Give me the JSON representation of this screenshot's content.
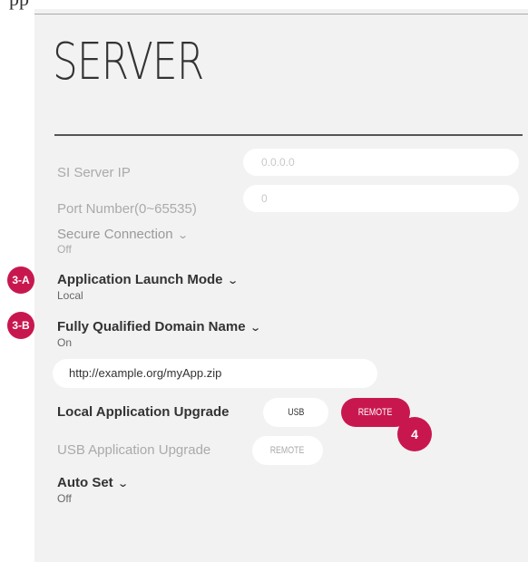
{
  "page_top_text": "pp",
  "title": "SERVER",
  "si_server_ip": {
    "label": "SI Server IP",
    "value": "0.0.0.0"
  },
  "port_number": {
    "label": "Port Number(0~65535)",
    "value": "0"
  },
  "secure_connection": {
    "label": "Secure Connection",
    "value": "Off"
  },
  "app_launch_mode": {
    "label": "Application Launch Mode",
    "value": "Local",
    "marker": "3-A"
  },
  "fqdn": {
    "label": "Fully Qualified Domain Name",
    "value": "On",
    "marker": "3-B",
    "url": "http://example.org/myApp.zip"
  },
  "local_upgrade": {
    "label": "Local Application Upgrade",
    "usb_label": "USB",
    "remote_label": "REMOTE",
    "marker": "4"
  },
  "usb_upgrade": {
    "label": "USB Application Upgrade",
    "remote_label": "REMOTE"
  },
  "auto_set": {
    "label": "Auto Set",
    "value": "Off"
  },
  "colors": {
    "accent": "#c8174f",
    "panel": "#f2f2f2",
    "disabled_text": "#aaaaaa"
  },
  "icons": {
    "dropdown": "chevron-down-icon"
  }
}
